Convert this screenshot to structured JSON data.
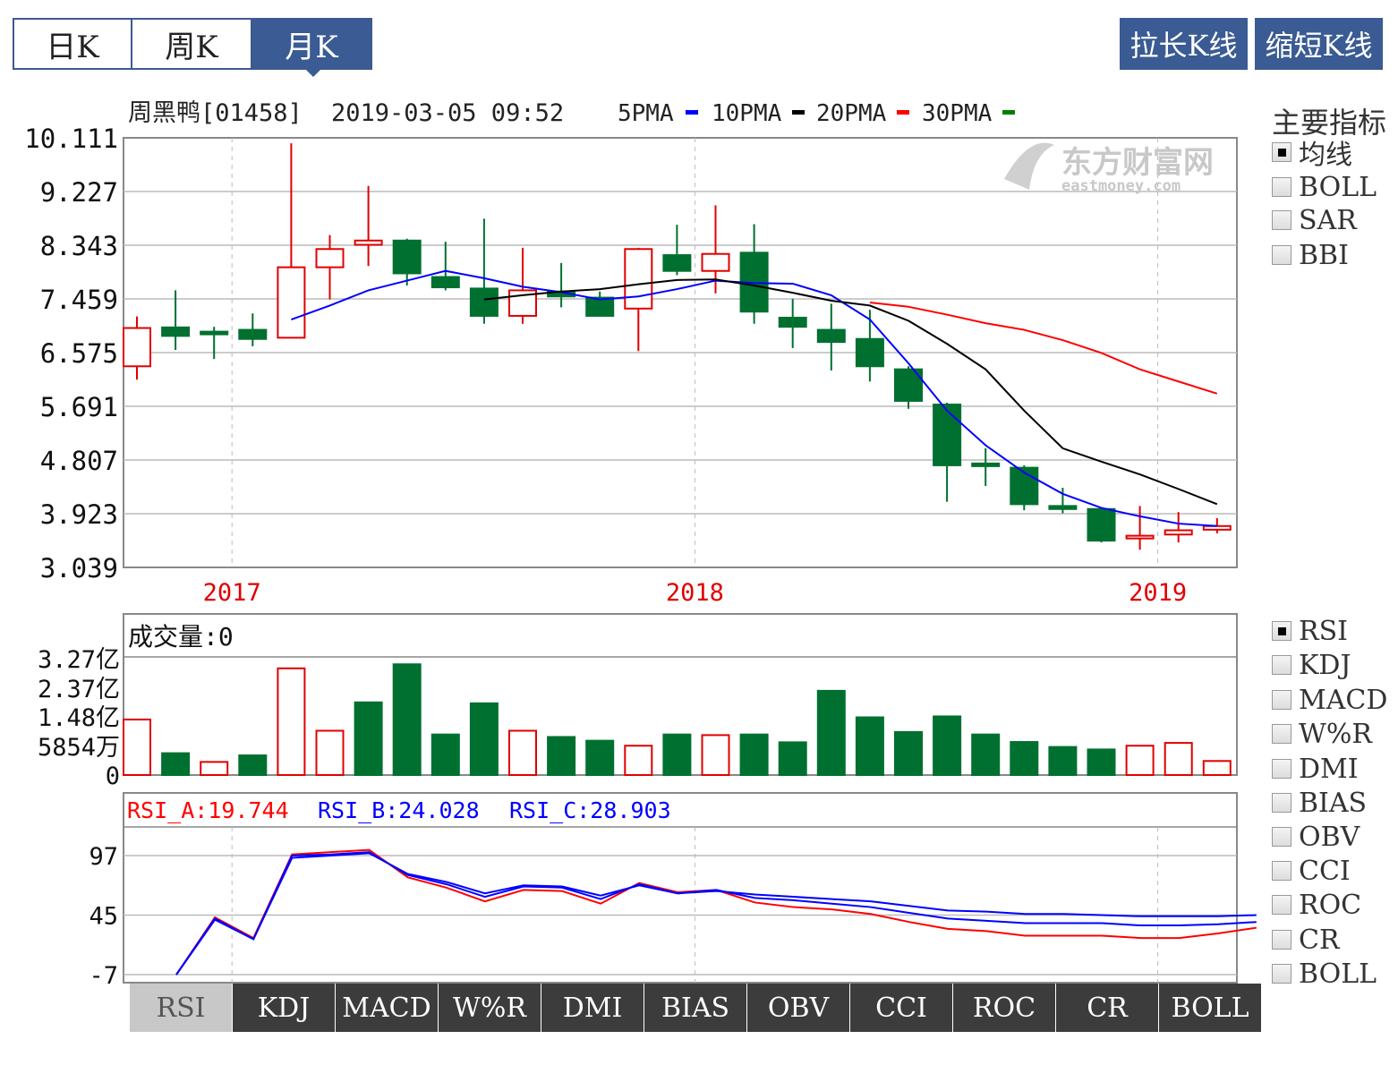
{
  "period_tabs": [
    {
      "label": "日K",
      "active": false
    },
    {
      "label": "周K",
      "active": false
    },
    {
      "label": "月K",
      "active": true
    }
  ],
  "zoom_buttons": {
    "lengthen": "拉长K线",
    "shorten": "缩短K线"
  },
  "header": {
    "stock": "周黑鸭[01458]",
    "datetime": "2019-03-05 09:52",
    "ma_legend": [
      {
        "label": "5PMA",
        "color": "#0000ff"
      },
      {
        "label": "10PMA",
        "color": "#000000"
      },
      {
        "label": "20PMA",
        "color": "#ff0000"
      },
      {
        "label": "30PMA",
        "color": "#008000"
      }
    ]
  },
  "watermark": {
    "cn": "东方财富网",
    "en": "eastmoney.com"
  },
  "main_indicators": {
    "title": "主要指标",
    "options": [
      {
        "label": "均线",
        "checked": true
      },
      {
        "label": "BOLL",
        "checked": false
      },
      {
        "label": "SAR",
        "checked": false
      },
      {
        "label": "BBI",
        "checked": false
      }
    ]
  },
  "sub_indicators": [
    {
      "label": "RSI",
      "checked": true
    },
    {
      "label": "KDJ",
      "checked": false
    },
    {
      "label": "MACD",
      "checked": false
    },
    {
      "label": "W%R",
      "checked": false
    },
    {
      "label": "DMI",
      "checked": false
    },
    {
      "label": "BIAS",
      "checked": false
    },
    {
      "label": "OBV",
      "checked": false
    },
    {
      "label": "CCI",
      "checked": false
    },
    {
      "label": "ROC",
      "checked": false
    },
    {
      "label": "CR",
      "checked": false
    },
    {
      "label": "BOLL",
      "checked": false
    }
  ],
  "bottom_tabs": [
    {
      "label": "RSI",
      "active": true
    },
    {
      "label": "KDJ",
      "active": false
    },
    {
      "label": "MACD",
      "active": false
    },
    {
      "label": "W%R",
      "active": false
    },
    {
      "label": "DMI",
      "active": false
    },
    {
      "label": "BIAS",
      "active": false
    },
    {
      "label": "OBV",
      "active": false
    },
    {
      "label": "CCI",
      "active": false
    },
    {
      "label": "ROC",
      "active": false
    },
    {
      "label": "CR",
      "active": false
    },
    {
      "label": "BOLL",
      "active": false
    }
  ],
  "colors": {
    "up": "#e00000",
    "down": "#007030",
    "accent": "#3a5b93",
    "year": "#e00000"
  },
  "chart_data": [
    {
      "type": "candlestick",
      "title": "周黑鸭[01458] 2019-03-05 09:52",
      "y_ticks": [
        "10.111",
        "9.227",
        "8.343",
        "7.459",
        "6.575",
        "5.691",
        "4.807",
        "3.923",
        "3.039"
      ],
      "ylim": [
        3.039,
        10.111
      ],
      "x_year_labels": [
        {
          "label": "2017",
          "index": 2
        },
        {
          "label": "2018",
          "index": 14
        },
        {
          "label": "2019",
          "index": 26
        }
      ],
      "candles": [
        {
          "o": 6.35,
          "h": 7.17,
          "l": 6.13,
          "c": 6.98
        },
        {
          "o": 6.99,
          "h": 7.6,
          "l": 6.62,
          "c": 6.85
        },
        {
          "o": 6.92,
          "h": 7.0,
          "l": 6.47,
          "c": 6.88
        },
        {
          "o": 6.95,
          "h": 7.22,
          "l": 6.68,
          "c": 6.8
        },
        {
          "o": 6.82,
          "h": 10.02,
          "l": 6.82,
          "c": 7.98
        },
        {
          "o": 7.98,
          "h": 8.51,
          "l": 7.45,
          "c": 8.28
        },
        {
          "o": 8.35,
          "h": 9.32,
          "l": 8.0,
          "c": 8.42
        },
        {
          "o": 8.42,
          "h": 8.45,
          "l": 7.68,
          "c": 7.88
        },
        {
          "o": 7.82,
          "h": 8.4,
          "l": 7.6,
          "c": 7.65
        },
        {
          "o": 7.63,
          "h": 8.78,
          "l": 7.05,
          "c": 7.18
        },
        {
          "o": 7.18,
          "h": 8.3,
          "l": 7.05,
          "c": 7.6
        },
        {
          "o": 7.58,
          "h": 8.05,
          "l": 7.32,
          "c": 7.5
        },
        {
          "o": 7.48,
          "h": 7.58,
          "l": 7.2,
          "c": 7.18
        },
        {
          "o": 7.3,
          "h": 8.3,
          "l": 6.6,
          "c": 8.28
        },
        {
          "o": 8.18,
          "h": 8.68,
          "l": 7.85,
          "c": 7.92
        },
        {
          "o": 7.92,
          "h": 9.0,
          "l": 7.55,
          "c": 8.2
        },
        {
          "o": 8.22,
          "h": 8.69,
          "l": 7.05,
          "c": 7.25
        },
        {
          "o": 7.15,
          "h": 7.46,
          "l": 6.65,
          "c": 7.0
        },
        {
          "o": 6.95,
          "h": 7.38,
          "l": 6.28,
          "c": 6.75
        },
        {
          "o": 6.8,
          "h": 7.28,
          "l": 6.1,
          "c": 6.35
        },
        {
          "o": 6.3,
          "h": 6.35,
          "l": 5.65,
          "c": 5.78
        },
        {
          "o": 5.72,
          "h": 5.75,
          "l": 4.12,
          "c": 4.72
        },
        {
          "o": 4.75,
          "h": 5.0,
          "l": 4.38,
          "c": 4.72
        },
        {
          "o": 4.68,
          "h": 4.72,
          "l": 3.98,
          "c": 4.08
        },
        {
          "o": 4.05,
          "h": 4.35,
          "l": 3.93,
          "c": 4.0
        },
        {
          "o": 4.0,
          "h": 4.02,
          "l": 3.45,
          "c": 3.48
        },
        {
          "o": 3.56,
          "h": 4.05,
          "l": 3.33,
          "c": 3.56
        },
        {
          "o": 3.58,
          "h": 3.95,
          "l": 3.45,
          "c": 3.65
        },
        {
          "o": 3.66,
          "h": 3.85,
          "l": 3.6,
          "c": 3.72
        }
      ],
      "ma5": [
        [
          4,
          7.12
        ],
        [
          5,
          7.35
        ],
        [
          6,
          7.6
        ],
        [
          7,
          7.76
        ],
        [
          8,
          7.92
        ],
        [
          9,
          7.8
        ],
        [
          10,
          7.66
        ],
        [
          11,
          7.57
        ],
        [
          12,
          7.45
        ],
        [
          13,
          7.5
        ],
        [
          14,
          7.62
        ],
        [
          15,
          7.76
        ],
        [
          16,
          7.72
        ],
        [
          17,
          7.71
        ],
        [
          18,
          7.52
        ],
        [
          19,
          7.12
        ],
        [
          20,
          6.4
        ],
        [
          21,
          5.62
        ],
        [
          22,
          5.05
        ],
        [
          23,
          4.6
        ],
        [
          24,
          4.25
        ],
        [
          25,
          4.02
        ],
        [
          26,
          3.88
        ],
        [
          27,
          3.76
        ],
        [
          28,
          3.72
        ]
      ],
      "ma10": [
        [
          9,
          7.45
        ],
        [
          10,
          7.52
        ],
        [
          11,
          7.58
        ],
        [
          12,
          7.62
        ],
        [
          13,
          7.7
        ],
        [
          14,
          7.77
        ],
        [
          15,
          7.78
        ],
        [
          16,
          7.68
        ],
        [
          17,
          7.56
        ],
        [
          18,
          7.43
        ],
        [
          19,
          7.35
        ],
        [
          20,
          7.1
        ],
        [
          21,
          6.72
        ],
        [
          22,
          6.3
        ],
        [
          23,
          5.62
        ],
        [
          24,
          5.0
        ],
        [
          25,
          4.78
        ],
        [
          26,
          4.57
        ],
        [
          27,
          4.33
        ],
        [
          28,
          4.08
        ]
      ],
      "ma20": [
        [
          19,
          7.4
        ],
        [
          20,
          7.33
        ],
        [
          21,
          7.2
        ],
        [
          22,
          7.06
        ],
        [
          23,
          6.95
        ],
        [
          24,
          6.78
        ],
        [
          25,
          6.57
        ],
        [
          26,
          6.3
        ],
        [
          27,
          6.1
        ],
        [
          28,
          5.9
        ]
      ]
    },
    {
      "type": "bar",
      "title": "成交量:0",
      "y_ticks": [
        "3.27亿",
        "2.37亿",
        "1.48亿",
        "5854万",
        "0"
      ],
      "volume_max": 3.5,
      "volume_units": "亿",
      "bars": [
        {
          "v": 1.78,
          "up": true
        },
        {
          "v": 0.7,
          "up": false
        },
        {
          "v": 0.42,
          "up": true
        },
        {
          "v": 0.63,
          "up": false
        },
        {
          "v": 3.42,
          "up": true
        },
        {
          "v": 1.42,
          "up": true
        },
        {
          "v": 2.33,
          "up": false,
          "outline": true
        },
        {
          "v": 3.55,
          "up": false
        },
        {
          "v": 1.3,
          "up": false
        },
        {
          "v": 2.3,
          "up": false
        },
        {
          "v": 1.42,
          "up": true
        },
        {
          "v": 1.22,
          "up": false
        },
        {
          "v": 1.1,
          "up": false
        },
        {
          "v": 0.94,
          "up": true
        },
        {
          "v": 1.3,
          "up": false
        },
        {
          "v": 1.28,
          "up": true
        },
        {
          "v": 1.3,
          "up": false
        },
        {
          "v": 1.05,
          "up": false
        },
        {
          "v": 2.7,
          "up": false
        },
        {
          "v": 1.85,
          "up": false
        },
        {
          "v": 1.38,
          "up": false
        },
        {
          "v": 1.88,
          "up": false
        },
        {
          "v": 1.3,
          "up": false
        },
        {
          "v": 1.06,
          "up": false
        },
        {
          "v": 0.9,
          "up": false
        },
        {
          "v": 0.82,
          "up": false
        },
        {
          "v": 0.94,
          "up": true
        },
        {
          "v": 1.03,
          "up": true
        },
        {
          "v": 0.45,
          "up": true
        }
      ]
    },
    {
      "type": "line",
      "legend": [
        {
          "label": "RSI_A:19.744",
          "color": "#ff0000"
        },
        {
          "label": "RSI_B:24.028",
          "color": "#0000ff"
        },
        {
          "label": "RSI_C:28.903",
          "color": "#0000ff"
        }
      ],
      "y_ticks": [
        "97",
        "45",
        "-7"
      ],
      "ylim": [
        -14,
        122
      ],
      "series": [
        {
          "color": "#ff0000",
          "values": [
            -7,
            43,
            25,
            98,
            100,
            102,
            78,
            69,
            57,
            67,
            66,
            55,
            73,
            65,
            67,
            56,
            52,
            50,
            46,
            39,
            33,
            31,
            27,
            27,
            27,
            25,
            25,
            29,
            34
          ]
        },
        {
          "color": "#0000ff",
          "values": [
            -7,
            42,
            24,
            97,
            98,
            100,
            80,
            72,
            61,
            70,
            69,
            59,
            72,
            64,
            67,
            60,
            58,
            55,
            52,
            47,
            42,
            40,
            38,
            38,
            38,
            36,
            36,
            37,
            39
          ]
        },
        {
          "color": "#0000ff",
          "values": [
            -7,
            41,
            24,
            95,
            97,
            99,
            81,
            74,
            64,
            71,
            70,
            62,
            71,
            64,
            66,
            63,
            61,
            59,
            57,
            53,
            49,
            48,
            46,
            46,
            45,
            44,
            44,
            44,
            45
          ]
        }
      ]
    }
  ]
}
